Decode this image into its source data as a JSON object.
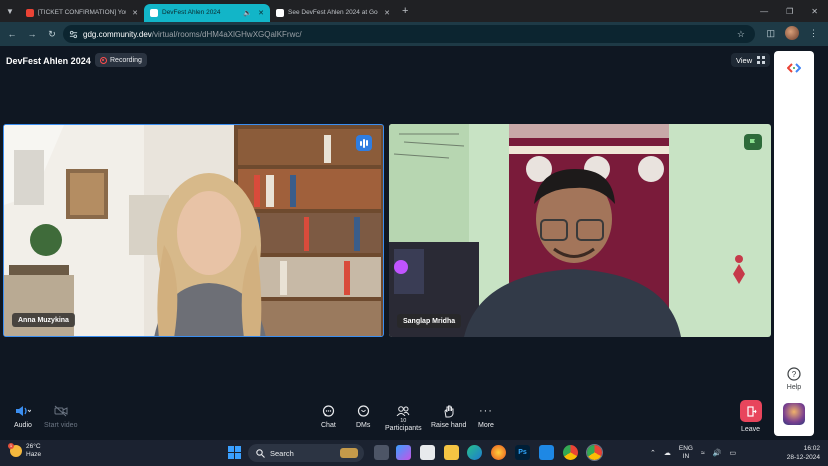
{
  "browser": {
    "tabs": [
      {
        "title": "[TICKET CONFIRMATION] You'r",
        "active": false,
        "favicon": "gmail-icon",
        "color": "#ea4335"
      },
      {
        "title": "DevFest Ahlen 2024",
        "active": true,
        "favicon": "gdg-icon",
        "color": "#ffffff"
      },
      {
        "title": "See DevFest Ahlen 2024 at Goo",
        "active": false,
        "favicon": "gdg-icon",
        "color": "#ffffff"
      }
    ],
    "url_host": "gdg.community.dev",
    "url_path": "/virtual/rooms/dHM4aXlGHwXGQalKFrwc/"
  },
  "meeting": {
    "title": "DevFest Ahlen 2024",
    "recording_label": "Recording",
    "view_label": "View",
    "participants": [
      {
        "name": "Anna Muzykina",
        "speaking": true
      },
      {
        "name": "Sanglap Mridha",
        "speaking": false
      }
    ]
  },
  "toolbar": {
    "audio": "Audio",
    "video": "Start video",
    "chat": "Chat",
    "dms": "DMs",
    "participants": "Participants",
    "participant_count": "10",
    "raise_hand": "Raise hand",
    "more": "More",
    "leave": "Leave"
  },
  "side_panel": {
    "help": "Help"
  },
  "taskbar": {
    "temperature": "26°C",
    "weather": "Haze",
    "weather_badge": "1",
    "search": "Search",
    "lang_top": "ENG",
    "lang_bottom": "IN",
    "time": "16:02",
    "date": "28-12-2024"
  },
  "colors": {
    "accent": "#12b5c8",
    "speaking_border": "#3b8ef0",
    "leave": "#e8455c"
  }
}
